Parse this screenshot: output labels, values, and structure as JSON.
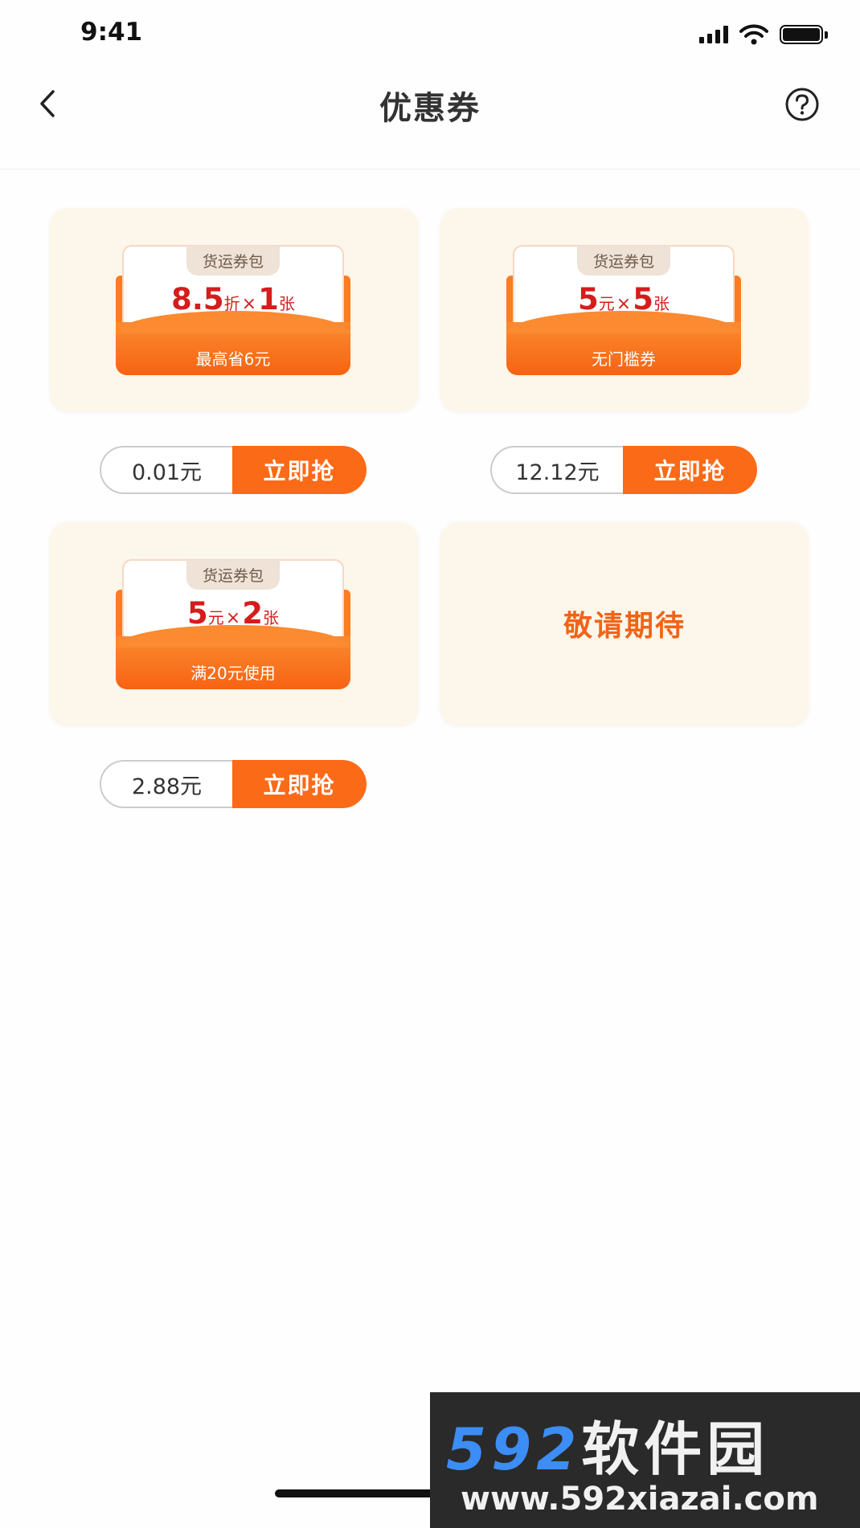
{
  "status_bar": {
    "time": "9:41"
  },
  "header": {
    "title": "优惠券",
    "back_icon": "chevron-left-icon",
    "help_icon": "question-circle-icon"
  },
  "coupons": [
    {
      "tag": "货运券包",
      "value": "8.5",
      "unit": "折",
      "times": "×",
      "count": "1",
      "count_unit": "张",
      "desc": "最高省6元",
      "price": "0.01元",
      "button": "立即抢"
    },
    {
      "tag": "货运券包",
      "value": "5",
      "unit": "元",
      "times": "×",
      "count": "5",
      "count_unit": "张",
      "desc": "无门槛券",
      "price": "12.12元",
      "button": "立即抢"
    },
    {
      "tag": "货运券包",
      "value": "5",
      "unit": "元",
      "times": "×",
      "count": "2",
      "count_unit": "张",
      "desc": "满20元使用",
      "price": "2.88元",
      "button": "立即抢"
    }
  ],
  "placeholder_card": {
    "text": "敬请期待"
  },
  "watermark": {
    "logo_num": "592",
    "logo_cn": "软件园",
    "url": "www.592xiazai.com"
  },
  "colors": {
    "accent": "#fb6a17",
    "value_red": "#d61c1c",
    "card_bg": "#fdf6ea"
  }
}
